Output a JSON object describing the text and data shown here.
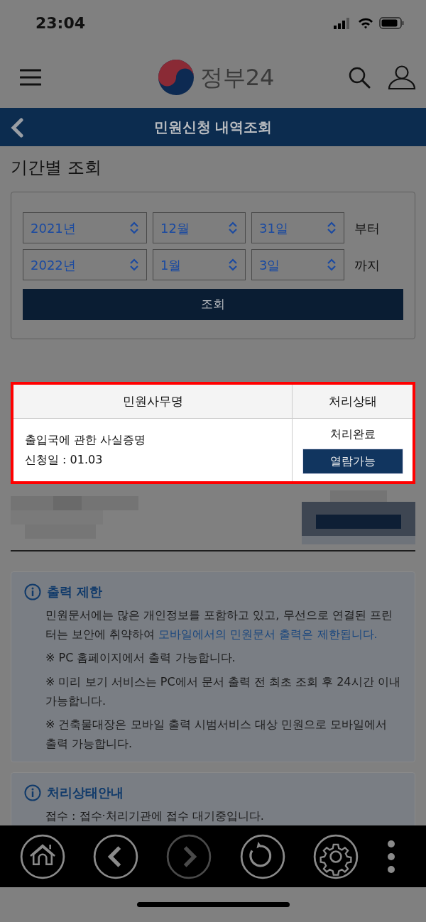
{
  "status_bar": {
    "time": "23:04"
  },
  "header": {
    "logo_text": "정부24"
  },
  "title_bar": {
    "title": "민원신청 내역조회"
  },
  "section_title": "기간별 조회",
  "date_range": [
    {
      "year": "2021년",
      "month": "12월",
      "day": "31일",
      "suffix": "부터"
    },
    {
      "year": "2022년",
      "month": "1월",
      "day": "3일",
      "suffix": "까지"
    }
  ],
  "search_button": "조회",
  "table": {
    "highlighted": true,
    "columns": [
      "민원사무명",
      "처리상태"
    ],
    "rows": [
      {
        "name": "출입국에 관한 사실증명",
        "date": "신청일 : 01.03",
        "status": "처리완료",
        "action": "열람가능"
      }
    ]
  },
  "notices": [
    {
      "title": "출력 제한",
      "paragraphs": [
        {
          "text": "민원문서에는 많은 개인정보를 포함하고 있고, 무선으로 연결된 프린터는 보안에 취약하여 ",
          "emphasis": "모바일에서의 민원문서 출력은 제한됩니다."
        },
        {
          "text": "※ PC 홈페이지에서 출력 가능합니다."
        },
        {
          "text": "※ 미리 보기 서비스는 PC에서 문서 출력 전 최초 조회 후 24시간 이내 가능합니다."
        },
        {
          "text": "※ 건축물대장은 모바일 출력 시범서비스 대상 민원으로 모바일에서 출력 가능합니다."
        }
      ]
    },
    {
      "title": "처리상태안내",
      "paragraphs": [
        {
          "text": "접수 : 접수·처리기관에 접수 대기중입니다."
        }
      ]
    }
  ],
  "toolbar": [
    {
      "kind": "home",
      "disabled": false
    },
    {
      "kind": "back",
      "disabled": false
    },
    {
      "kind": "forward",
      "disabled": true
    },
    {
      "kind": "reload",
      "disabled": false
    },
    {
      "kind": "settings",
      "disabled": false
    },
    {
      "kind": "more",
      "disabled": false
    }
  ]
}
